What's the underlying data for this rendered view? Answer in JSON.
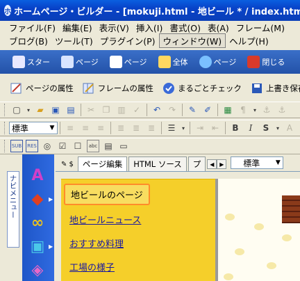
{
  "window": {
    "title": "ホームページ・ビルダー - [mokuji.html - 地ビール * / index.html - 地..."
  },
  "menu": {
    "row1": [
      "ファイル(F)",
      "編集(E)",
      "表示(V)",
      "挿入(I)",
      "書式(O)",
      "表(A)",
      "フレーム(M)"
    ],
    "row2": [
      "ブログ(B)",
      "ツール(T)",
      "プラグイン(P)",
      "ウィンドウ(W)",
      "ヘルプ(H)"
    ]
  },
  "site_toolbar": [
    "スター",
    "ページ",
    "ページ",
    "全体",
    "ページ",
    "閉じる"
  ],
  "page_toolbar": [
    "ページの属性",
    "フレームの属性",
    "まるごとチェック",
    "上書き保存"
  ],
  "format": {
    "style_select": "標準"
  },
  "left_panel": {
    "vertical_tab": "ナビメニュー"
  },
  "editor_tabs": {
    "tabs": [
      "ページ編集",
      "HTML ソース",
      "プ"
    ],
    "standard_select": "標準"
  },
  "nav_links": [
    "地ビールのページ",
    "地ビールニュース",
    "おすすめ料理",
    "工場の様子"
  ],
  "colors": {
    "nav_bg": "#f5cf2a",
    "selection": "#ff8c2a",
    "titlebar": "#0a5fe0"
  }
}
